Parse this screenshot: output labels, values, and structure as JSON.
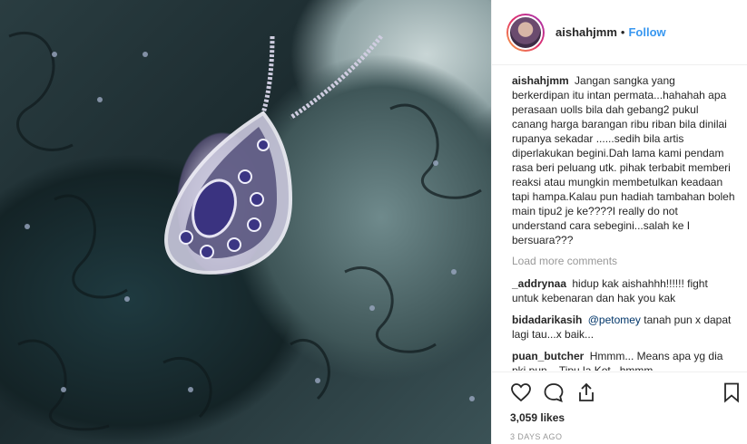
{
  "post": {
    "username": "aishahjmm",
    "dot": "•",
    "follow_label": "Follow"
  },
  "caption": {
    "username": "aishahjmm",
    "text": "Jangan sangka yang berkerdipan itu intan permata...hahahah apa perasaan uolls bila dah gebang2 pukul canang harga barangan ribu riban bila dinilai rupanya sekadar ......sedih bila artis diperlakukan begini.Dah lama kami pendam rasa beri peluang utk. pihak terbabit memberi reaksi atau mungkin membetulkan keadaan tapi hampa.Kalau pun hadiah tambahan boleh main tipu2 je ke????I really do not understand cara sebegini...salah ke I bersuara???"
  },
  "load_more_label": "Load more comments",
  "comments": [
    {
      "username": "_addrynaa",
      "text": "hidup kak aishahhh!!!!!! fight untuk kebenaran dan hak you kak"
    },
    {
      "username": "bidadarikasih",
      "mention": "@petomey",
      "text": "tanah pun x dapat lagi tau...x baik..."
    },
    {
      "username": "puan_butcher",
      "text": "Hmmm... Means apa yg dia pki pun... Tipu la Kot...hmmm"
    }
  ],
  "likes": "3,059 likes",
  "date": "3 DAYS AGO",
  "icons": {
    "like": "heart-icon",
    "comment": "comment-icon",
    "share": "share-icon",
    "save": "bookmark-icon"
  }
}
